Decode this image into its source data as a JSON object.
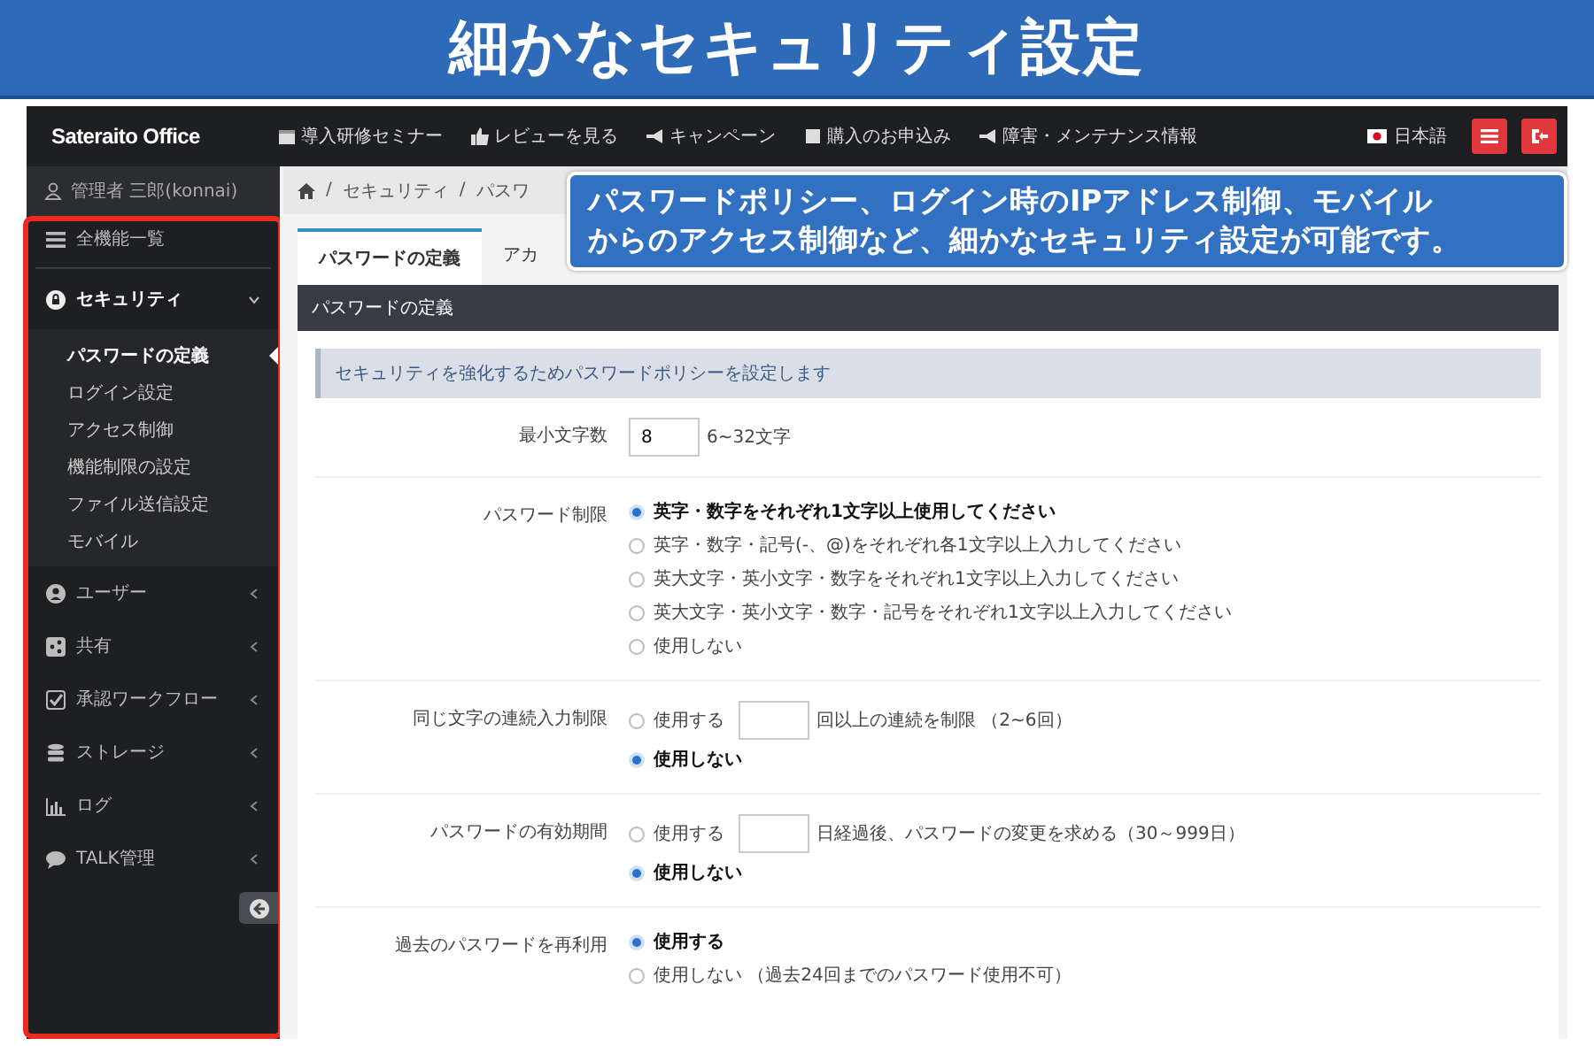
{
  "banner": {
    "title": "細かなセキュリティ設定"
  },
  "callout": {
    "lines": [
      "パスワードポリシー、ログイン時のIPアドレス制御、モバイル",
      "からのアクセス制御など、細かなセキュリティ設定が可能です。"
    ]
  },
  "topbar": {
    "logo": "Sateraito Office",
    "nav": [
      "導入研修セミナー",
      "レビューを見る",
      "キャンペーン",
      "購入のお申込み",
      "障害・メンテナンス情報"
    ],
    "language": "日本語"
  },
  "sidebar": {
    "user": "管理者 三郎(konnai)",
    "items": [
      {
        "label": "全機能一覧"
      },
      {
        "label": "セキュリティ",
        "expanded": true,
        "children": [
          {
            "label": "パスワードの定義",
            "selected": true
          },
          {
            "label": "ログイン設定",
            "selected": false
          },
          {
            "label": "アクセス制御",
            "selected": false
          },
          {
            "label": "機能制限の設定",
            "selected": false
          },
          {
            "label": "ファイル送信設定",
            "selected": false
          },
          {
            "label": "モバイル",
            "selected": false
          }
        ]
      },
      {
        "label": "ユーザー",
        "expanded": false
      },
      {
        "label": "共有",
        "expanded": false
      },
      {
        "label": "承認ワークフロー",
        "expanded": false
      },
      {
        "label": "ストレージ",
        "expanded": false
      },
      {
        "label": "ログ",
        "expanded": false
      },
      {
        "label": "TALK管理",
        "expanded": false
      }
    ]
  },
  "breadcrumb": [
    {
      "separator": "/",
      "label": "セキュリティ"
    },
    {
      "separator": "/",
      "label": "パスワ"
    }
  ],
  "tabs": [
    {
      "label": "パスワードの定義",
      "selected": true
    },
    {
      "label": "アカ",
      "selected": false
    }
  ],
  "panel": {
    "title": "パスワードの定義",
    "info": "セキュリティを強化するためパスワードポリシーを設定します",
    "rows": [
      {
        "label": "最小文字数",
        "kind": "number",
        "value": "8",
        "hint": "6~32文字"
      },
      {
        "label": "パスワード制限",
        "kind": "radio",
        "options": [
          {
            "label": "英字・数字をそれぞれ1文字以上使用してください",
            "selected": true
          },
          {
            "label": "英字・数字・記号(-、@)をそれぞれ各1文字以上入力してください",
            "selected": false
          },
          {
            "label": "英大文字・英小文字・数字をそれぞれ1文字以上入力してください",
            "selected": false
          },
          {
            "label": "英大文字・英小文字・数字・記号をそれぞれ1文字以上入力してください",
            "selected": false
          },
          {
            "label": "使用しない",
            "selected": false
          }
        ]
      },
      {
        "label": "同じ文字の連続入力制限",
        "kind": "radio",
        "options": [
          {
            "label": "使用する",
            "selected": false,
            "suffix": "回以上の連続を制限 （2~6回）"
          },
          {
            "label": "使用しない",
            "selected": true
          }
        ]
      },
      {
        "label": "パスワードの有効期間",
        "kind": "radio",
        "options": [
          {
            "label": "使用する",
            "selected": false,
            "suffix": "日経過後、パスワードの変更を求める（30～999日）"
          },
          {
            "label": "使用しない",
            "selected": true
          }
        ]
      },
      {
        "label": "過去のパスワードを再利用",
        "kind": "radio",
        "options": [
          {
            "label": "使用する",
            "selected": true
          },
          {
            "label": "使用しない （過去24回までのパスワード使用不可）",
            "selected": false
          }
        ]
      }
    ]
  }
}
